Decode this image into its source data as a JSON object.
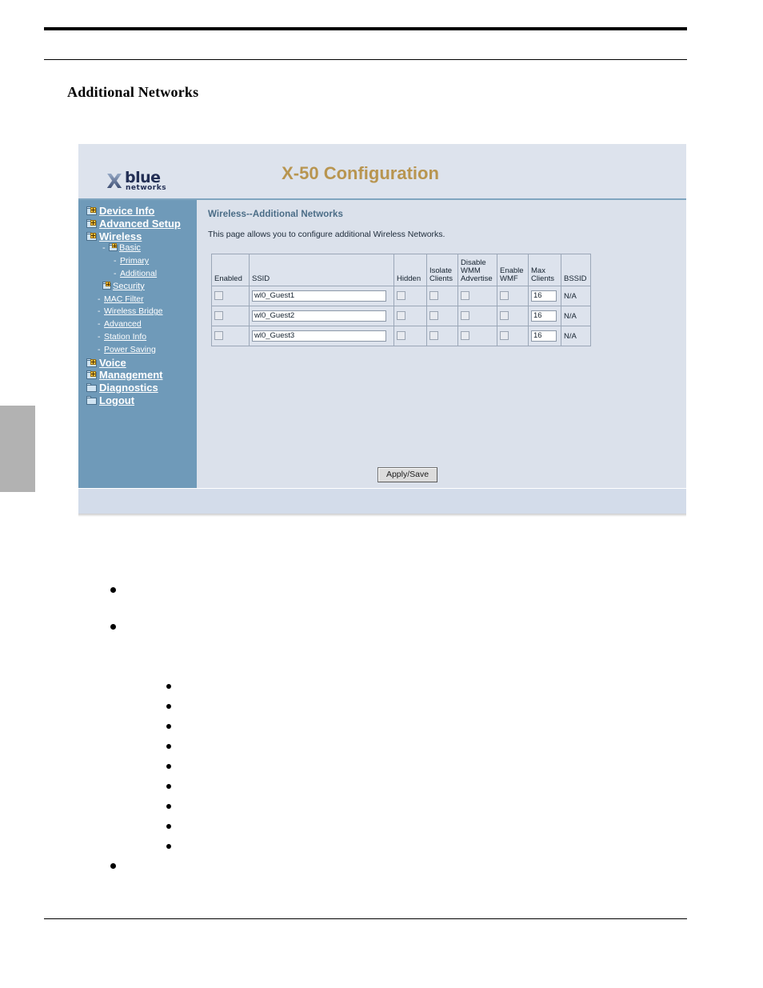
{
  "page": {
    "heading": "Additional Networks"
  },
  "screenshot": {
    "brand": {
      "x_glyph": "X",
      "name": "blue",
      "tagline": "networks"
    },
    "title": "X-50 Configuration",
    "sidebar": {
      "items": [
        {
          "label": "Device Info",
          "level": 1,
          "icon": "folder-plus-icon"
        },
        {
          "label": "Advanced Setup",
          "level": 1,
          "icon": "folder-plus-icon"
        },
        {
          "label": "Wireless",
          "level": 1,
          "icon": "folder-plus-icon"
        },
        {
          "label": "Basic",
          "level": 2,
          "icon": "folder-plus-icon"
        },
        {
          "label": "Primary",
          "level": 3,
          "icon": "dash-icon"
        },
        {
          "label": "Additional",
          "level": 3,
          "icon": "dash-icon"
        },
        {
          "label": "Security",
          "level": 2,
          "icon": "folder-plus-icon"
        },
        {
          "label": "MAC Filter",
          "level": 4,
          "icon": "dash-icon"
        },
        {
          "label": "Wireless Bridge",
          "level": 4,
          "icon": "dash-icon"
        },
        {
          "label": "Advanced",
          "level": 4,
          "icon": "dash-icon"
        },
        {
          "label": "Station Info",
          "level": 4,
          "icon": "dash-icon"
        },
        {
          "label": "Power Saving",
          "level": 4,
          "icon": "dash-icon"
        },
        {
          "label": "Voice",
          "level": 1,
          "icon": "folder-plus-icon"
        },
        {
          "label": "Management",
          "level": 1,
          "icon": "folder-plus-icon"
        },
        {
          "label": "Diagnostics",
          "level": 1,
          "icon": "folder-icon"
        },
        {
          "label": "Logout",
          "level": 1,
          "icon": "folder-icon"
        }
      ]
    },
    "content": {
      "title": "Wireless--Additional Networks",
      "description": "This page allows you to configure additional Wireless Networks.",
      "table": {
        "headers": [
          "Enabled",
          "SSID",
          "Hidden",
          "Isolate Clients",
          "Disable WMM Advertise",
          "Enable WMF",
          "Max Clients",
          "BSSID"
        ],
        "headers_wrapped": {
          "isolate": [
            "Isolate",
            "Clients"
          ],
          "wmm": [
            "Disable",
            "WMM",
            "Advertise"
          ],
          "wmf": [
            "Enable",
            "WMF"
          ],
          "max": [
            "Max",
            "Clients"
          ]
        },
        "rows": [
          {
            "enabled": false,
            "ssid": "wl0_Guest1",
            "hidden": false,
            "isolate_clients": false,
            "disable_wmm_advertise": false,
            "enable_wmf": false,
            "max_clients": "16",
            "bssid": "N/A"
          },
          {
            "enabled": false,
            "ssid": "wl0_Guest2",
            "hidden": false,
            "isolate_clients": false,
            "disable_wmm_advertise": false,
            "enable_wmf": false,
            "max_clients": "16",
            "bssid": "N/A"
          },
          {
            "enabled": false,
            "ssid": "wl0_Guest3",
            "hidden": false,
            "isolate_clients": false,
            "disable_wmm_advertise": false,
            "enable_wmf": false,
            "max_clients": "16",
            "bssid": "N/A"
          }
        ]
      },
      "apply_button": "Apply/Save"
    },
    "colors": {
      "sidebar_bg": "#6f9ab9",
      "content_bg": "#dbe1eb",
      "header_bg": "#dde3ed",
      "title_text": "#b89550",
      "content_title_text": "#4a6c86",
      "accent_rule": "#7fa5c0"
    }
  },
  "bullets": {
    "outer_top": [
      "",
      ""
    ],
    "inner": [
      "",
      "",
      "",
      "",
      "",
      "",
      "",
      "",
      ""
    ],
    "outer_bottom": [
      ""
    ]
  }
}
